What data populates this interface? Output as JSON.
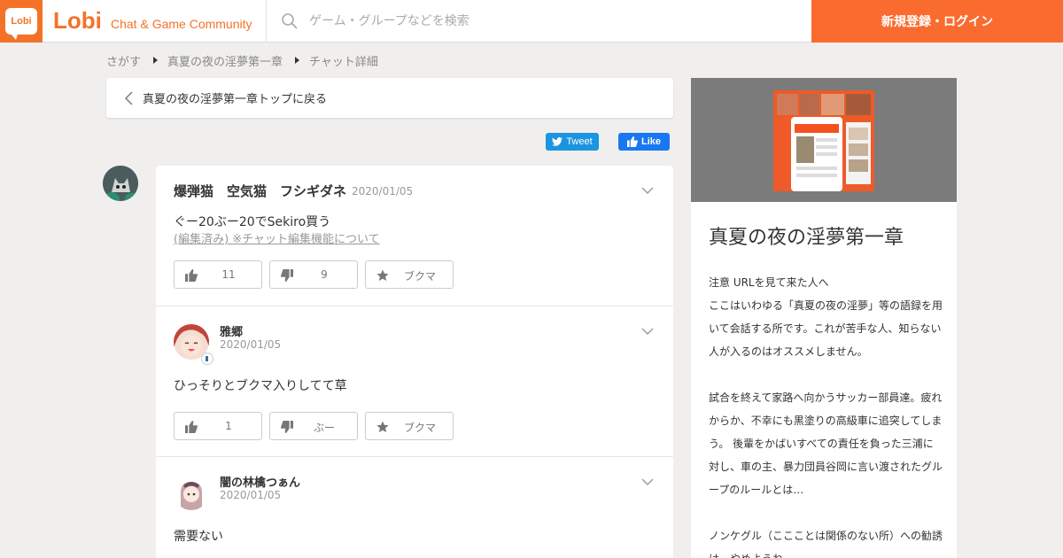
{
  "header": {
    "logo_text": "Lobi",
    "brand": "Lobi",
    "tagline": "Chat & Game Community",
    "search_placeholder": "ゲーム・グループなどを検索",
    "login_label": "新規登録・ログイン",
    "accent_color": "#fa6b30"
  },
  "breadcrumb": {
    "items": [
      "さがす",
      "真夏の夜の淫夢第一章",
      "チャット詳細"
    ]
  },
  "back_link": {
    "label": "真夏の夜の淫夢第一章トップに戻る"
  },
  "social": {
    "tweet_label": "Tweet",
    "like_label": "Like"
  },
  "messages": [
    {
      "author": "爆弾猫　空気猫　フシギダネ",
      "date": "2020/01/05",
      "text": "ぐー20ぶー20でSekiro買う",
      "edit_note": "(編集済み) ※チャット編集機能について",
      "actions": [
        {
          "icon": "thumbs-up-icon",
          "label": "11"
        },
        {
          "icon": "thumbs-down-icon",
          "label": "9"
        },
        {
          "icon": "star-icon",
          "label": "ブクマ"
        }
      ]
    },
    {
      "author": "雅郷",
      "date": "2020/01/05",
      "text": "ひっそりとブクマ入りしてて草",
      "actions": [
        {
          "icon": "thumbs-up-icon",
          "label": "1"
        },
        {
          "icon": "thumbs-down-icon",
          "label": "ぶー"
        },
        {
          "icon": "star-icon",
          "label": "ブクマ"
        }
      ]
    },
    {
      "author": "闇の林檎つぁん",
      "date": "2020/01/05",
      "text": "需要ない"
    }
  ],
  "sidebar": {
    "group_title": "真夏の夜の淫夢第一章",
    "description": "注意 URLを見て来た人へ\nここはいわゆる「真夏の夜の淫夢」等の語録を用いて会話する所です。これが苦手な人、知らない人が入るのはオススメしません。\n\n試合を終えて家路へ向かうサッカー部員達。疲れからか、不幸にも黒塗りの高級車に追突してしまう。 後輩をかばいすべての責任を負った三浦に対し、車の主、暴力団員谷岡に言い渡されたグループのルールとは…\n\nノンケグル（ここことは関係のない所）への勧誘は…やめようね"
  }
}
